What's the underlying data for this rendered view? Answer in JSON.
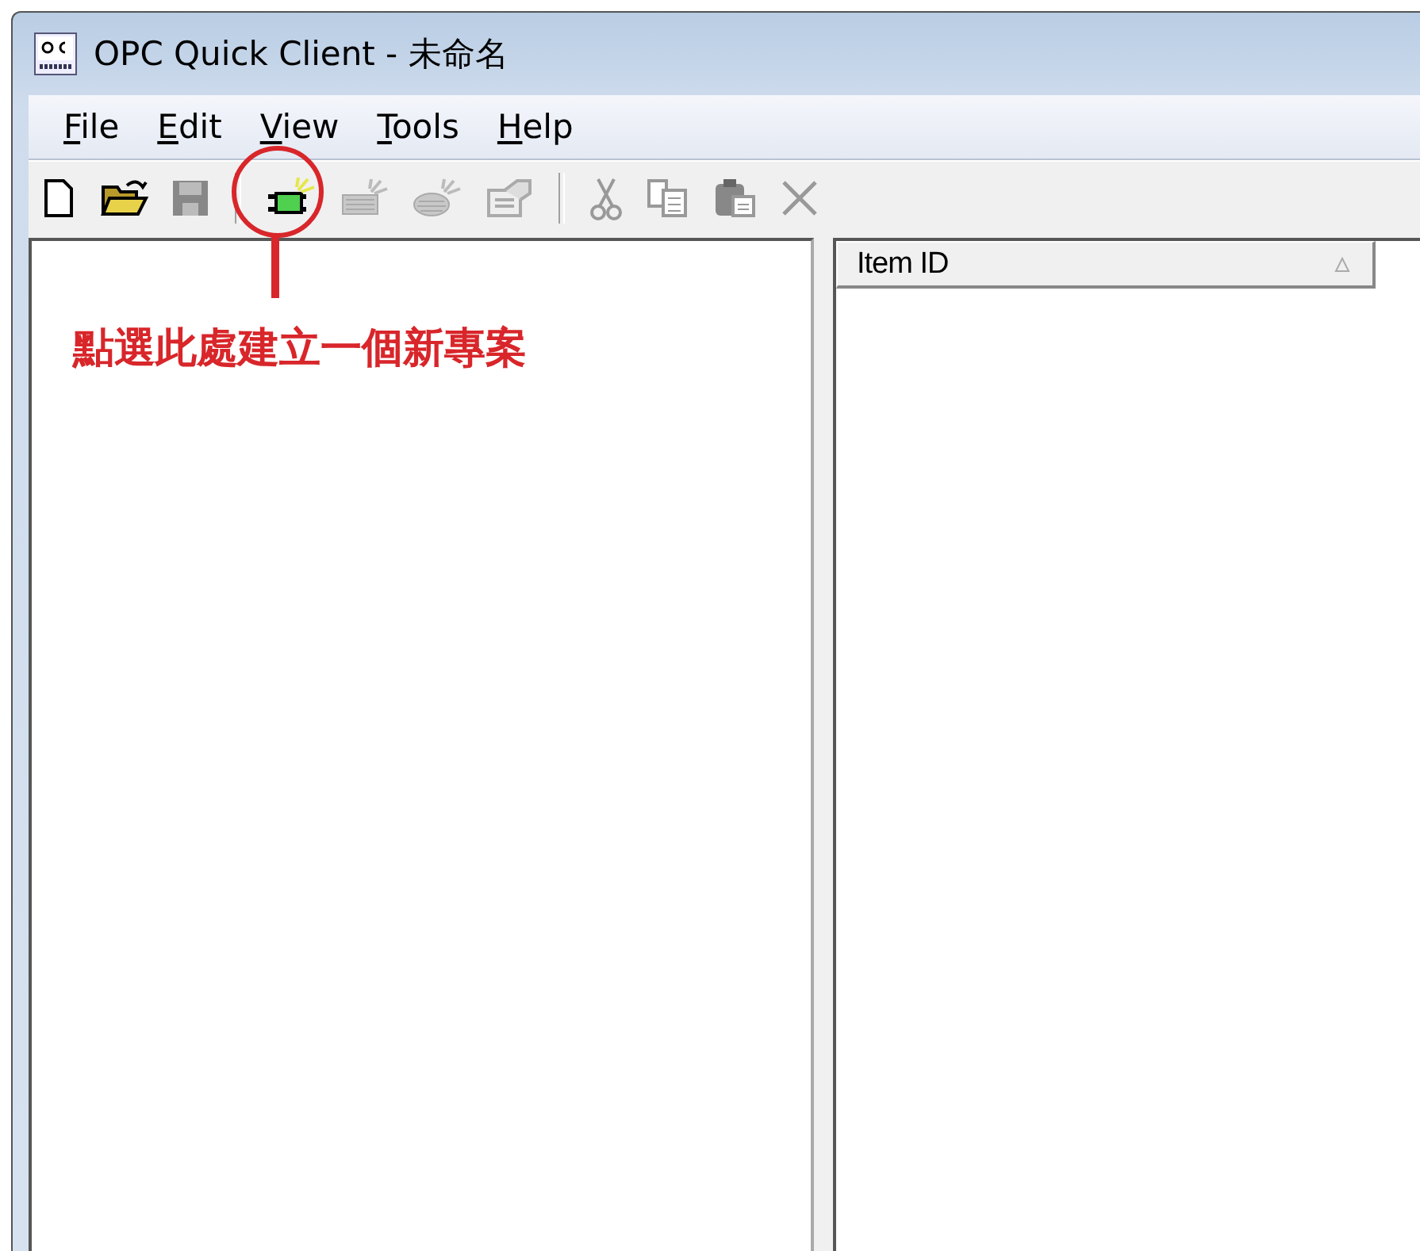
{
  "window": {
    "title": "OPC Quick Client - 未命名"
  },
  "menu": [
    {
      "label": "File"
    },
    {
      "label": "Edit"
    },
    {
      "label": "View"
    },
    {
      "label": "Tools"
    },
    {
      "label": "Help"
    }
  ],
  "toolbar": [
    {
      "kind": "new",
      "disabled": false
    },
    {
      "kind": "open",
      "disabled": false
    },
    {
      "kind": "save",
      "disabled": true
    },
    {
      "kind": "separator"
    },
    {
      "kind": "server",
      "disabled": false
    },
    {
      "kind": "group",
      "disabled": true
    },
    {
      "kind": "item",
      "disabled": true
    },
    {
      "kind": "properties",
      "disabled": true
    },
    {
      "kind": "separator"
    },
    {
      "kind": "cut",
      "disabled": true
    },
    {
      "kind": "copy",
      "disabled": true
    },
    {
      "kind": "paste",
      "disabled": true
    },
    {
      "kind": "delete",
      "disabled": true
    }
  ],
  "item_list": {
    "columns": [
      {
        "label": "Item ID"
      }
    ]
  },
  "annotation": {
    "text": "點選此處建立一個新專案"
  }
}
